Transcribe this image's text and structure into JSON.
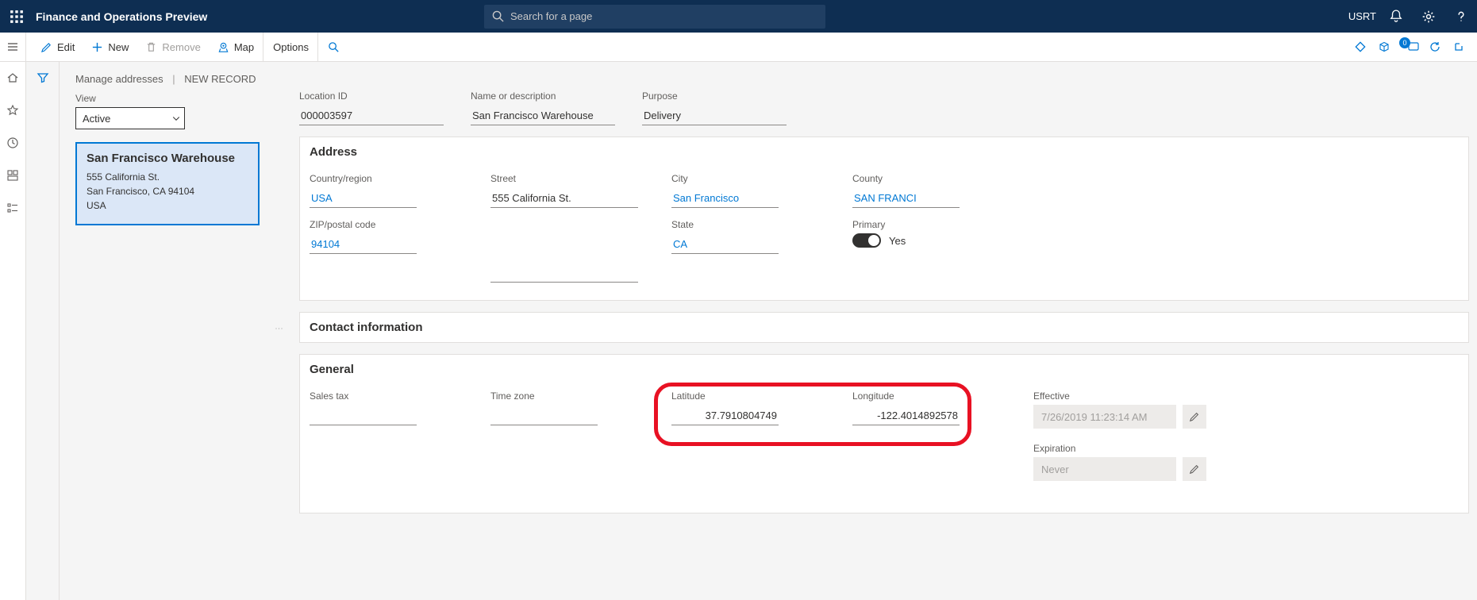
{
  "header": {
    "title": "Finance and Operations Preview",
    "search_placeholder": "Search for a page",
    "company": "USRT"
  },
  "actionbar": {
    "edit": "Edit",
    "new": "New",
    "remove": "Remove",
    "map": "Map",
    "options": "Options",
    "badge_count": "0"
  },
  "breadcrumb": {
    "a": "Manage addresses",
    "b": "NEW RECORD"
  },
  "sidepanel": {
    "view_label": "View",
    "view_value": "Active",
    "card_title": "San Francisco Warehouse",
    "card_line1": "555 California St.",
    "card_line2": "San Francisco, CA 94104",
    "card_line3": "USA"
  },
  "fields_top": {
    "location_id": {
      "label": "Location ID",
      "value": "000003597"
    },
    "name": {
      "label": "Name or description",
      "value": "San Francisco Warehouse"
    },
    "purpose": {
      "label": "Purpose",
      "value": "Delivery"
    }
  },
  "sections": {
    "address_title": "Address",
    "contact_title": "Contact information",
    "general_title": "General"
  },
  "address": {
    "country": {
      "label": "Country/region",
      "value": "USA"
    },
    "street": {
      "label": "Street",
      "value": "555 California St."
    },
    "city": {
      "label": "City",
      "value": "San Francisco"
    },
    "county": {
      "label": "County",
      "value": "SAN FRANCI"
    },
    "zip": {
      "label": "ZIP/postal code",
      "value": "94104"
    },
    "state": {
      "label": "State",
      "value": "CA"
    },
    "primary": {
      "label": "Primary",
      "value": "Yes"
    }
  },
  "general": {
    "salestax": {
      "label": "Sales tax",
      "value": ""
    },
    "timezone": {
      "label": "Time zone",
      "value": ""
    },
    "lat": {
      "label": "Latitude",
      "value": "37.7910804749"
    },
    "lon": {
      "label": "Longitude",
      "value": "-122.4014892578"
    },
    "effective": {
      "label": "Effective",
      "value": "7/26/2019 11:23:14 AM"
    },
    "expiration": {
      "label": "Expiration",
      "value": "Never"
    }
  }
}
